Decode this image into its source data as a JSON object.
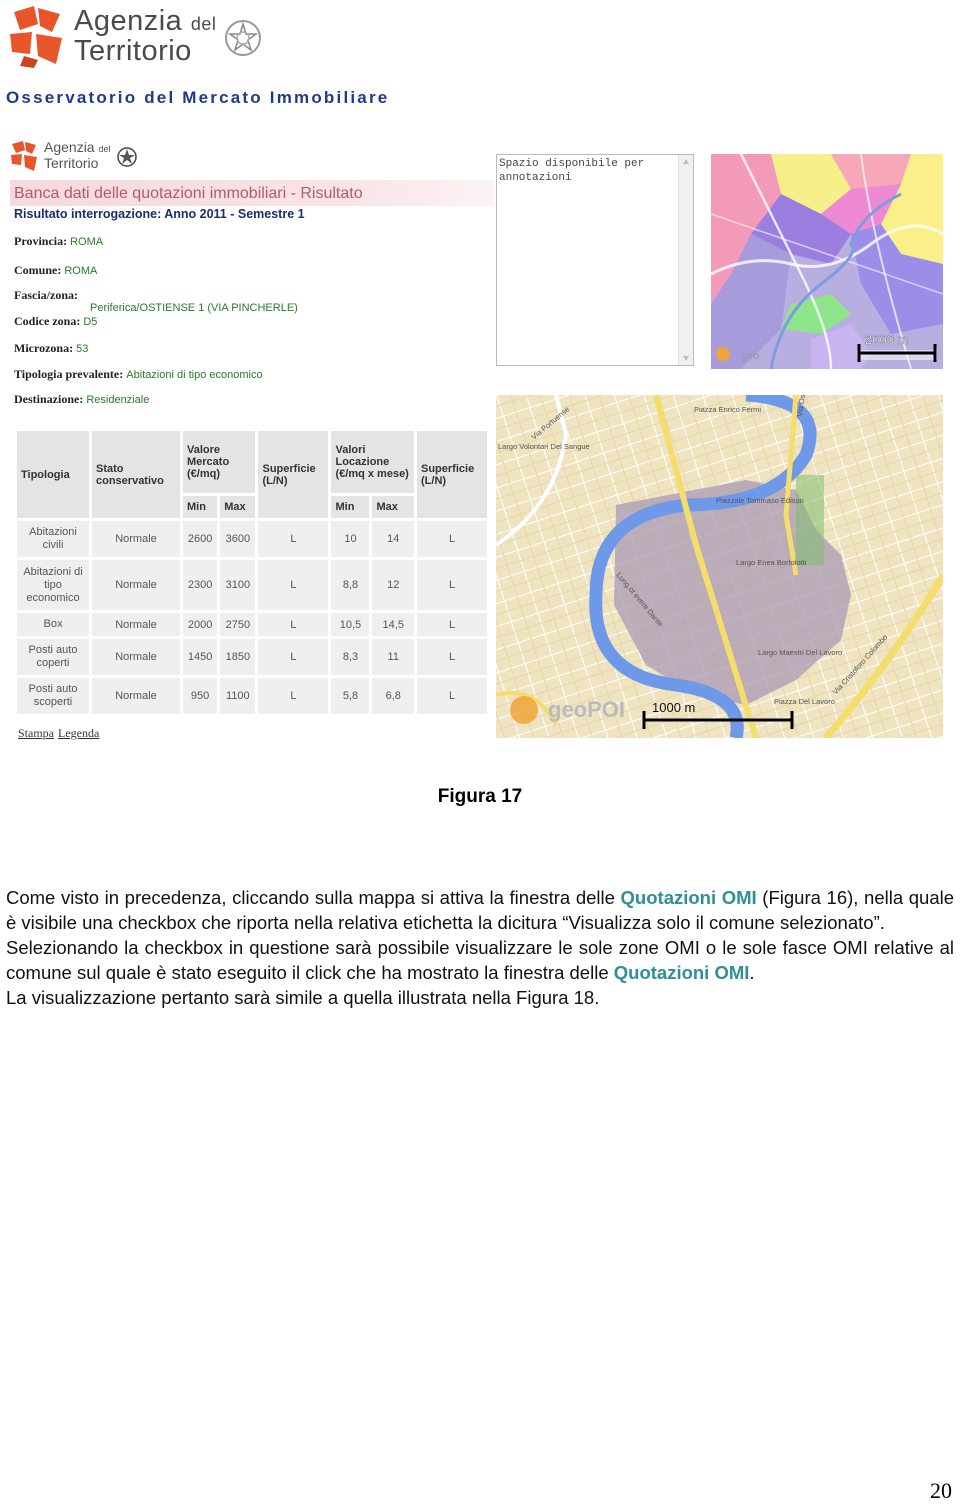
{
  "header": {
    "agenzia": "Agenzia",
    "del": "del",
    "territorio": "Territorio",
    "subtitle": "Osservatorio del Mercato Immobiliare"
  },
  "figure": {
    "logo_agenzia": "Agenzia",
    "logo_del": "del",
    "logo_territorio": "Territorio",
    "banner": "Banca dati delle quotazioni immobiliari - Risultato",
    "result": "Risultato interrogazione: Anno 2011 - Semestre 1",
    "fields": {
      "provincia_label": "Provincia:",
      "provincia": "ROMA",
      "comune_label": "Comune:",
      "comune": "ROMA",
      "fascia_label": "Fascia/zona:",
      "fascia": "Periferica/OSTIENSE 1 (VIA PINCHERLE)",
      "codice_label": "Codice zona:",
      "codice": "D5",
      "microzona_label": "Microzona:",
      "microzona": "53",
      "tipologia_label": "Tipologia prevalente:",
      "tipologia": "Abitazioni di tipo economico",
      "destinazione_label": "Destinazione:",
      "destinazione": "Residenziale"
    },
    "table": {
      "headers": {
        "tipologia": "Tipologia",
        "stato": "Stato conservativo",
        "valore": "Valore Mercato (€/mq)",
        "superficie1": "Superficie (L/N)",
        "locazione": "Valori Locazione (€/mq x mese)",
        "superficie2": "Superficie (L/N)",
        "min1": "Min",
        "max1": "Max",
        "min2": "Min",
        "max2": "Max"
      },
      "rows": [
        [
          "Abitazioni civili",
          "Normale",
          "2600",
          "3600",
          "L",
          "10",
          "14",
          "L"
        ],
        [
          "Abitazioni di tipo economico",
          "Normale",
          "2300",
          "3100",
          "L",
          "8,8",
          "12",
          "L"
        ],
        [
          "Box",
          "Normale",
          "2000",
          "2750",
          "L",
          "10,5",
          "14,5",
          "L"
        ],
        [
          "Posti auto coperti",
          "Normale",
          "1450",
          "1850",
          "L",
          "8,3",
          "11",
          "L"
        ],
        [
          "Posti auto scoperti",
          "Normale",
          "950",
          "1100",
          "L",
          "5,8",
          "6,8",
          "L"
        ]
      ]
    },
    "links": {
      "stampa": "Stampa",
      "legenda": "Legenda"
    },
    "notes": "Spazio disponibile per annotazioni",
    "map1_scale": "2000 m",
    "map2_scale": "1000 m",
    "map2_brand": "geoPOI",
    "map1_brand": "geo",
    "map2_labels": {
      "portuense": "Via Portuense",
      "enrico_fermi": "Piazza Enrico Fermi",
      "ostiense": "Via Osti",
      "volontari": "Largo Volontari Del Sangue",
      "edison": "Piazzale Tommaso Edison",
      "bortolotti": "Largo Enea Bortolotti",
      "lungotevere": "Lung.ot evere Dante",
      "maestri": "Largo Maestri Del Lavoro",
      "colombo": "Via Cristoforo Colombo",
      "piazza_lavoro": "Piazza Del Lavoro"
    }
  },
  "caption": "Figura 17",
  "body": {
    "p1_a": "Come visto in precedenza, cliccando sulla mappa si attiva la finestra delle ",
    "p1_hl": "Quotazioni OMI",
    "p1_b": " (Figura 16), nella quale è visibile una checkbox  che riporta nella relativa etichetta la dicitura “Visualizza solo il comune selezionato”.",
    "p2_a": "Selezionando la checkbox in questione sarà possibile visualizzare le sole zone OMI o le sole fasce OMI relative al comune sul quale è stato eseguito il click che ha mostrato la finestra delle ",
    "p2_hl": "Quotazioni OMI",
    "p2_b": ".",
    "p3": "La visualizzazione pertanto sarà simile a quella illustrata nella Figura 18."
  },
  "page_number": "20",
  "colors": {
    "brand_orange": "#e8552a",
    "subtitle_blue": "#1f3a8a",
    "highlight_teal": "#2d8f98",
    "value_green": "#2a7a2a"
  }
}
